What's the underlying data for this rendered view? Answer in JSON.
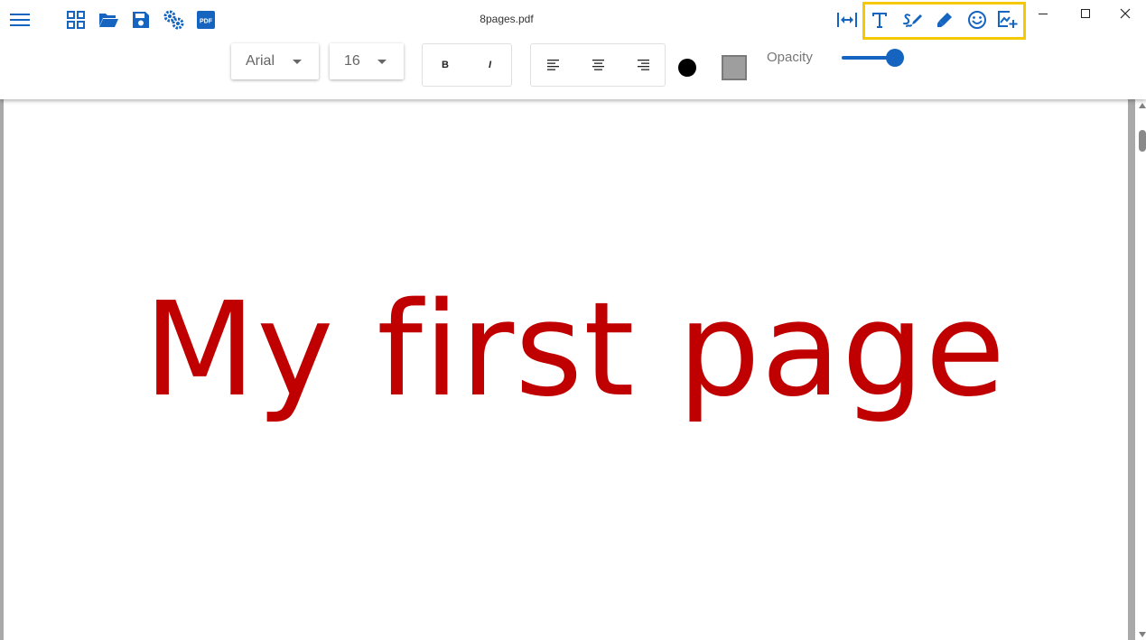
{
  "app": {
    "document_title": "8pages.pdf"
  },
  "toolbar": {
    "left_icons": [
      "menu-icon",
      "grid-view-icon",
      "folder-open-icon",
      "save-icon",
      "settings-icon",
      "pdf-icon"
    ],
    "right_icons": [
      "fit-width-icon",
      "text-tool-icon",
      "signature-icon",
      "highlight-pen-icon",
      "emoji-icon",
      "add-image-icon"
    ],
    "highlighted_group": [
      "text-tool-icon",
      "signature-icon",
      "highlight-pen-icon",
      "emoji-icon",
      "add-image-icon"
    ]
  },
  "format_bar": {
    "font_family": "Arial",
    "font_size": "16",
    "bold_label": "B",
    "italic_label": "I",
    "align_options": [
      "align-left",
      "align-center",
      "align-right"
    ],
    "text_color": "#000000",
    "fill_color": "#9e9e9e",
    "opacity_label": "Opacity",
    "opacity_value": 1.0
  },
  "page": {
    "text": "My first page",
    "text_color": "#c00000"
  },
  "colors": {
    "accent": "#1565c0",
    "highlight": "#f5c800"
  }
}
